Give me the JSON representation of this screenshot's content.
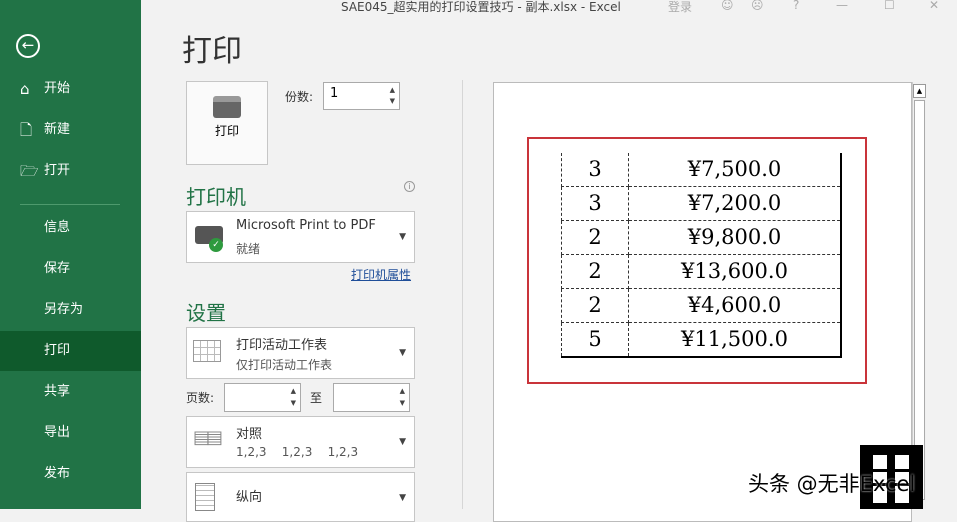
{
  "window": {
    "title": "SAE045_超实用的打印设置技巧 - 副本.xlsx  -  Excel",
    "login": "登录",
    "smile": "☺",
    "frown": "☹",
    "help": "?",
    "min": "—",
    "max": "☐",
    "close": "✕"
  },
  "sidebar": {
    "back": "←",
    "items": [
      {
        "label": "开始",
        "icon": "⌂"
      },
      {
        "label": "新建",
        "icon": "🗋"
      },
      {
        "label": "打开",
        "icon": "🗁"
      },
      {
        "label": "信息"
      },
      {
        "label": "保存"
      },
      {
        "label": "另存为"
      },
      {
        "label": "打印",
        "active": true
      },
      {
        "label": "共享"
      },
      {
        "label": "导出"
      },
      {
        "label": "发布"
      }
    ]
  },
  "main": {
    "title": "打印",
    "print_button": "打印",
    "copies_label": "份数:",
    "copies_value": "1",
    "printer_heading": "打印机",
    "printer_name": "Microsoft Print to PDF",
    "printer_status": "就绪",
    "printer_props": "打印机属性",
    "info": "i",
    "settings_heading": "设置",
    "scope_title": "打印活动工作表",
    "scope_sub": "仅打印活动工作表",
    "pages_label": "页数:",
    "pages_to": "至",
    "collate_title": "对照",
    "collate_sub": "1,2,3    1,2,3    1,2,3",
    "orientation": "纵向"
  },
  "preview": {
    "rows": [
      [
        "3",
        "¥7,500.0"
      ],
      [
        "3",
        "¥7,200.0"
      ],
      [
        "2",
        "¥9,800.0"
      ],
      [
        "2",
        "¥13,600.0"
      ],
      [
        "2",
        "¥4,600.0"
      ],
      [
        "5",
        "¥11,500.0"
      ]
    ],
    "highlight_color": "#c9343a"
  },
  "watermark": "头条 @无非Excel"
}
